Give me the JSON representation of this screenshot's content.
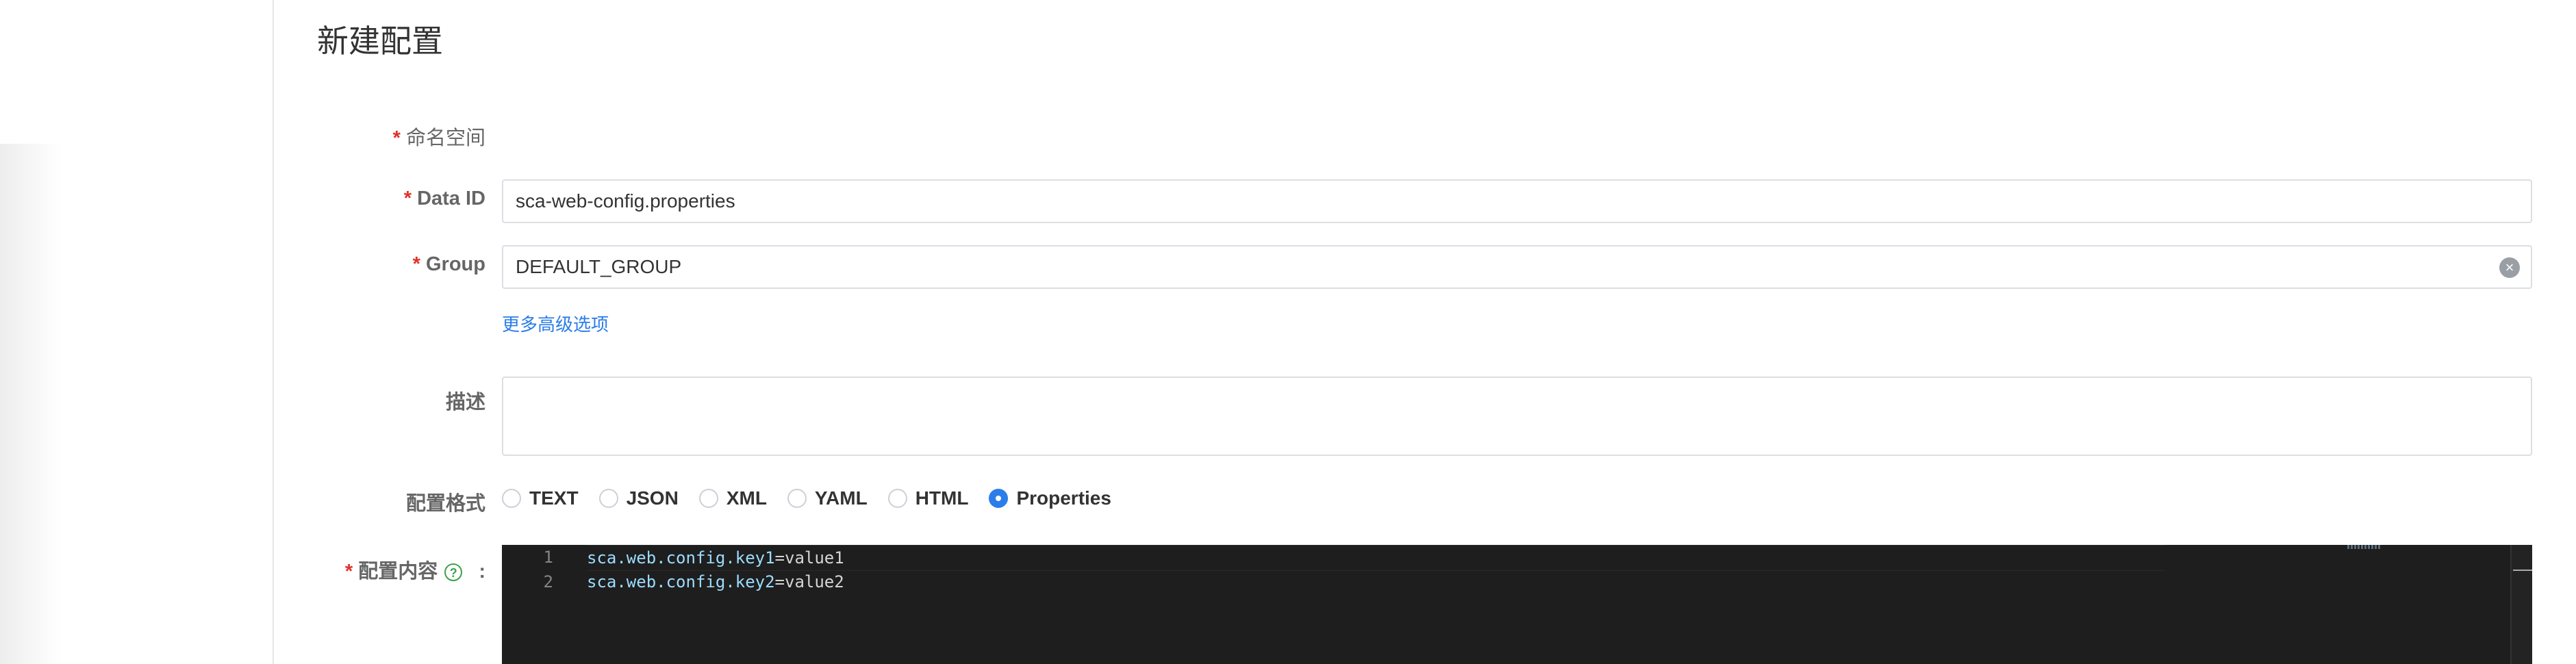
{
  "page": {
    "title": "新建配置"
  },
  "form": {
    "namespace": {
      "label": "命名空间"
    },
    "data_id": {
      "label": "Data ID",
      "value": "sca-web-config.properties"
    },
    "group": {
      "label": "Group",
      "value": "DEFAULT_GROUP",
      "clear_icon": "⊗"
    },
    "advanced_link": "更多高级选项",
    "description": {
      "label": "描述",
      "value": ""
    },
    "format": {
      "label": "配置格式",
      "options": [
        "TEXT",
        "JSON",
        "XML",
        "YAML",
        "HTML",
        "Properties"
      ],
      "selected": "Properties"
    },
    "content": {
      "label": "配置内容",
      "colon": ":",
      "help_icon": "?",
      "lines": [
        {
          "num": "1",
          "key": "sca.web.config.key1",
          "eq": "=",
          "value": "value1"
        },
        {
          "num": "2",
          "key": "sca.web.config.key2",
          "eq": "=",
          "value": "value2"
        }
      ]
    }
  },
  "colors": {
    "accent": "#2b7de9",
    "required": "#e0312a",
    "editor_bg": "#1e1e1e"
  }
}
